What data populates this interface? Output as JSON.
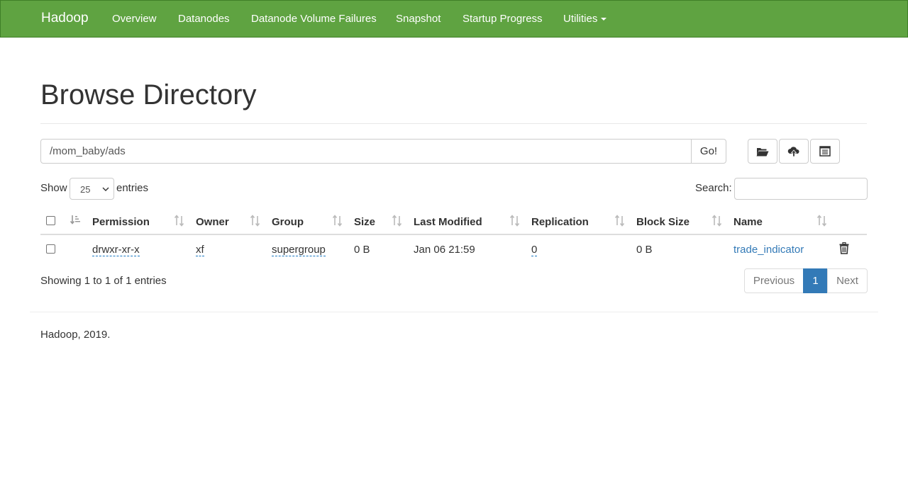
{
  "navbar": {
    "brand": "Hadoop",
    "items": [
      {
        "label": "Overview"
      },
      {
        "label": "Datanodes"
      },
      {
        "label": "Datanode Volume Failures"
      },
      {
        "label": "Snapshot"
      },
      {
        "label": "Startup Progress"
      },
      {
        "label": "Utilities"
      }
    ],
    "color": "#5fa341"
  },
  "page": {
    "title": "Browse Directory",
    "path_value": "/mom_baby/ads",
    "go_label": "Go!",
    "icons": [
      "folder-open-icon",
      "cloud-upload-icon",
      "list-alt-icon"
    ]
  },
  "table_controls": {
    "show_label": "Show",
    "page_length": "25",
    "entries_label": "entries",
    "search_label": "Search:",
    "search_value": ""
  },
  "table": {
    "columns": [
      "Permission",
      "Owner",
      "Group",
      "Size",
      "Last Modified",
      "Replication",
      "Block Size",
      "Name"
    ],
    "rows": [
      {
        "permission": "drwxr-xr-x",
        "owner": "xf",
        "group": "supergroup",
        "size": "0 B",
        "last_modified": "Jan 06 21:59",
        "replication": "0",
        "block_size": "0 B",
        "name": "trade_indicator"
      }
    ],
    "info": "Showing 1 to 1 of 1 entries"
  },
  "pagination": {
    "previous": "Previous",
    "current": "1",
    "next": "Next",
    "accent": "#337ab7"
  },
  "footer": {
    "text": "Hadoop, 2019."
  }
}
